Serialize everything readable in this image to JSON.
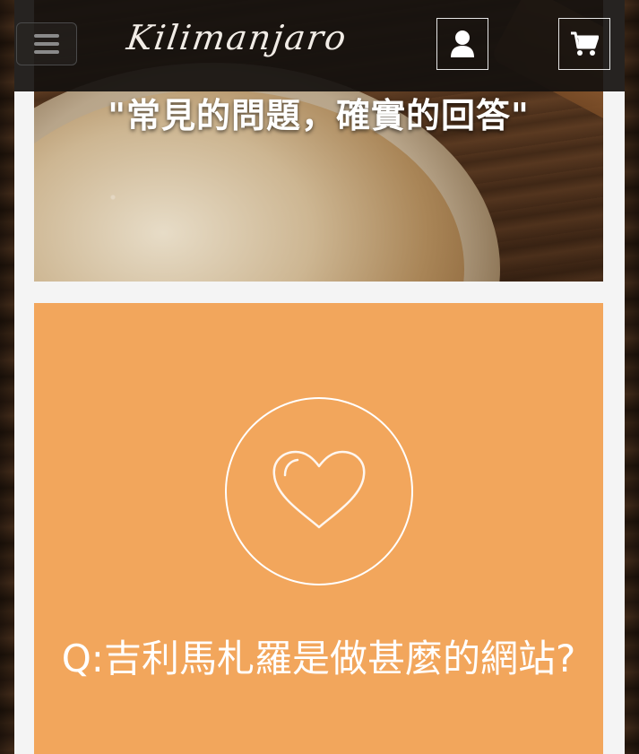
{
  "header": {
    "logo_text": "Kilimanjaro",
    "menu_icon": "hamburger-menu-icon",
    "user_icon": "user-icon",
    "cart_icon": "cart-icon"
  },
  "hero": {
    "title": "\"常見的問題，確實的回答\""
  },
  "faq_card": {
    "icon": "heart-icon",
    "question": "Q:吉利馬札羅是做甚麼的網站?"
  },
  "colors": {
    "header_bg": "#14100e",
    "card_bg": "#f2a65c",
    "page_bg": "#f4f4f4",
    "text_light": "#ffffff"
  }
}
